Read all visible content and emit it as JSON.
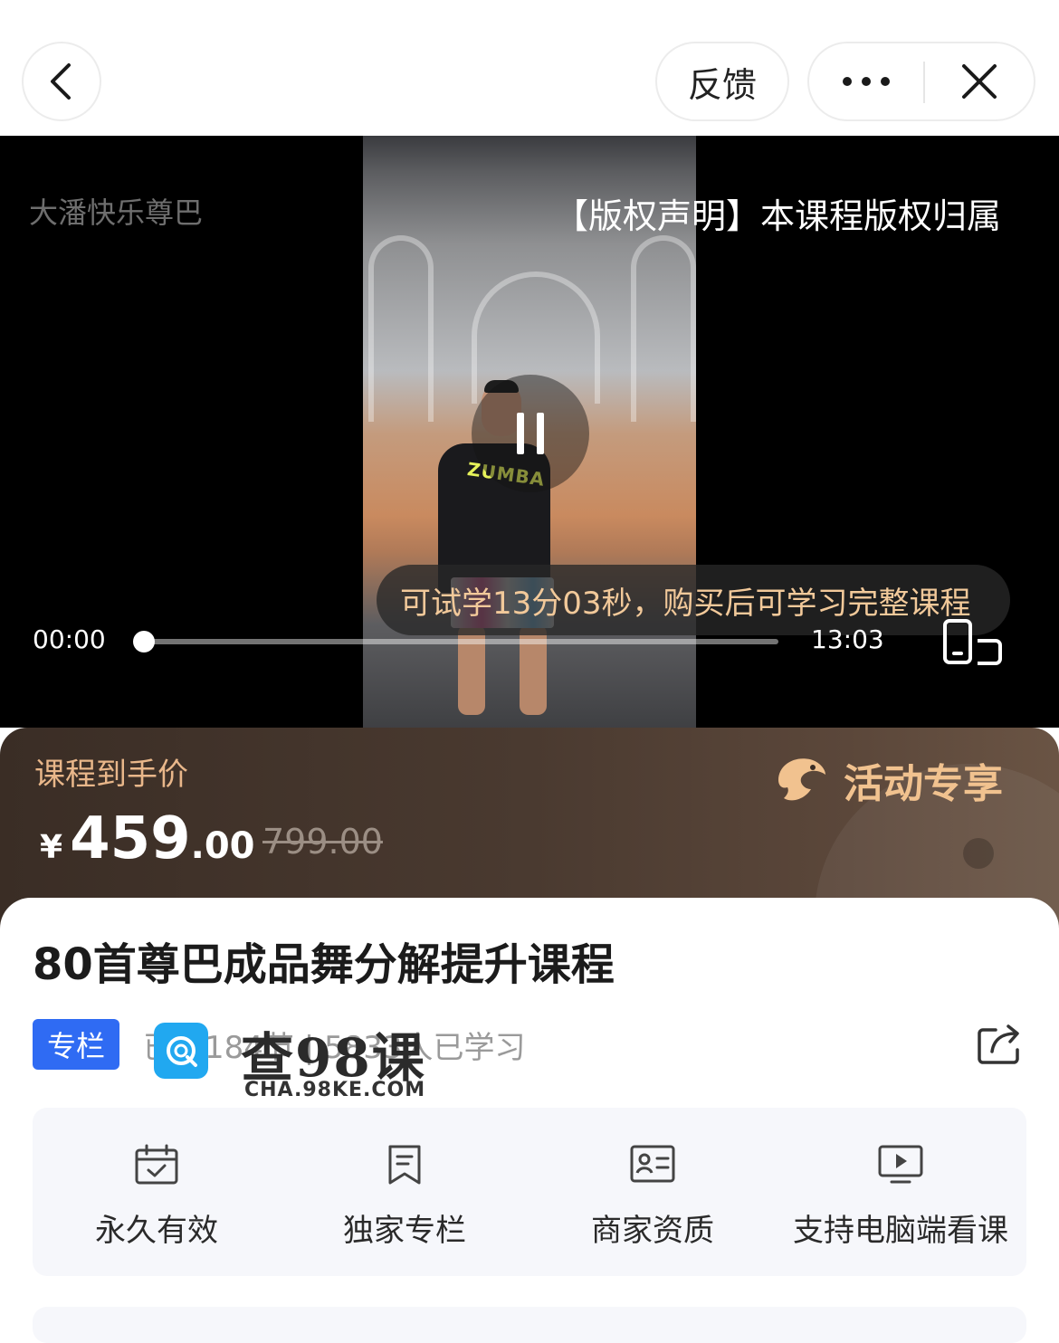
{
  "header": {
    "feedback_label": "反馈"
  },
  "video": {
    "channel_name": "大潘快乐尊巴",
    "copyright_text": "【版权声明】本课程版权归属",
    "shirt_text": "ZUMBA",
    "trial_notice": "可试学13分03秒，购买后可学习完整课程",
    "current_time": "00:00",
    "total_time": "13:03",
    "progress": 0
  },
  "price": {
    "label": "课程到手价",
    "currency": "¥",
    "integer": "459",
    "decimal": ".00",
    "original": "799.00",
    "promo_text": "活动专享"
  },
  "course": {
    "title": "80首尊巴成品舞分解提升课程",
    "tag": "专栏",
    "meta": "已更184节 | 5833人已学习"
  },
  "features": [
    {
      "label": "永久有效",
      "icon": "calendar-check-icon"
    },
    {
      "label": "独家专栏",
      "icon": "bookmark-icon"
    },
    {
      "label": "商家资质",
      "icon": "id-card-icon"
    },
    {
      "label": "支持电脑端看课",
      "icon": "monitor-play-icon"
    }
  ],
  "watermark": {
    "cn": "查98课",
    "en": "CHA.98KE.COM"
  },
  "colors": {
    "accent_blue": "#2f6bf3",
    "price_gold": "#e9b78a",
    "promo_gold": "#f1c28f",
    "trial_text": "#f2c99a"
  }
}
